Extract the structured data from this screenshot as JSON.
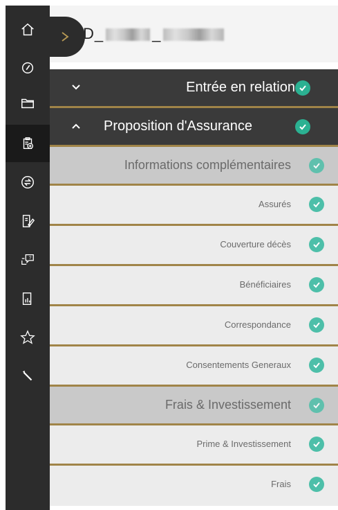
{
  "header": {
    "id_prefix": "D_",
    "id_separator": "_"
  },
  "rail": {
    "icons": [
      "home-icon",
      "gauge-icon",
      "folder-icon",
      "clipboard-add-icon",
      "exchange-icon",
      "document-edit-icon",
      "chat-question-icon",
      "report-icon",
      "star-icon",
      "wrench-icon"
    ],
    "active": "clipboard-add-icon"
  },
  "sections": {
    "entree": {
      "label": "Entrée en relation"
    },
    "proposition": {
      "label": "Proposition d'Assurance"
    }
  },
  "groups": {
    "infos": {
      "label": "Informations complémentaires",
      "items": [
        "Assurés",
        "Couverture décès",
        "Bénéficiaires",
        "Correspondance",
        "Consentements Generaux"
      ]
    },
    "frais": {
      "label": "Frais & Investissement",
      "items": [
        "Prime & Investissement",
        "Frais"
      ]
    }
  },
  "colors": {
    "rail": "#2c2c2c",
    "section_bg": "#3a3a3a",
    "gold_divider": "#a08448",
    "check": "#4dbfa9"
  }
}
